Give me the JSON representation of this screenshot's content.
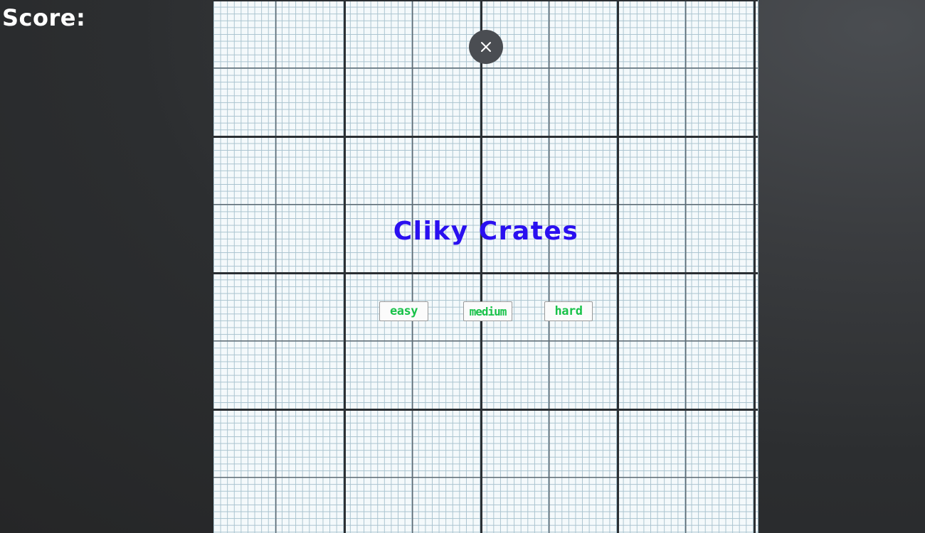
{
  "hud": {
    "score_label": "Score:"
  },
  "game": {
    "title": "Cliky Crates",
    "close_icon": "close-x-icon"
  },
  "difficulty": {
    "easy_label": "easy",
    "medium_label": "medium",
    "hard_label": "hard"
  },
  "colors": {
    "title": "#2a10f0",
    "button_text": "#19c24a",
    "close_button_bg": "#4a4d52",
    "background": "#2c2e30"
  }
}
